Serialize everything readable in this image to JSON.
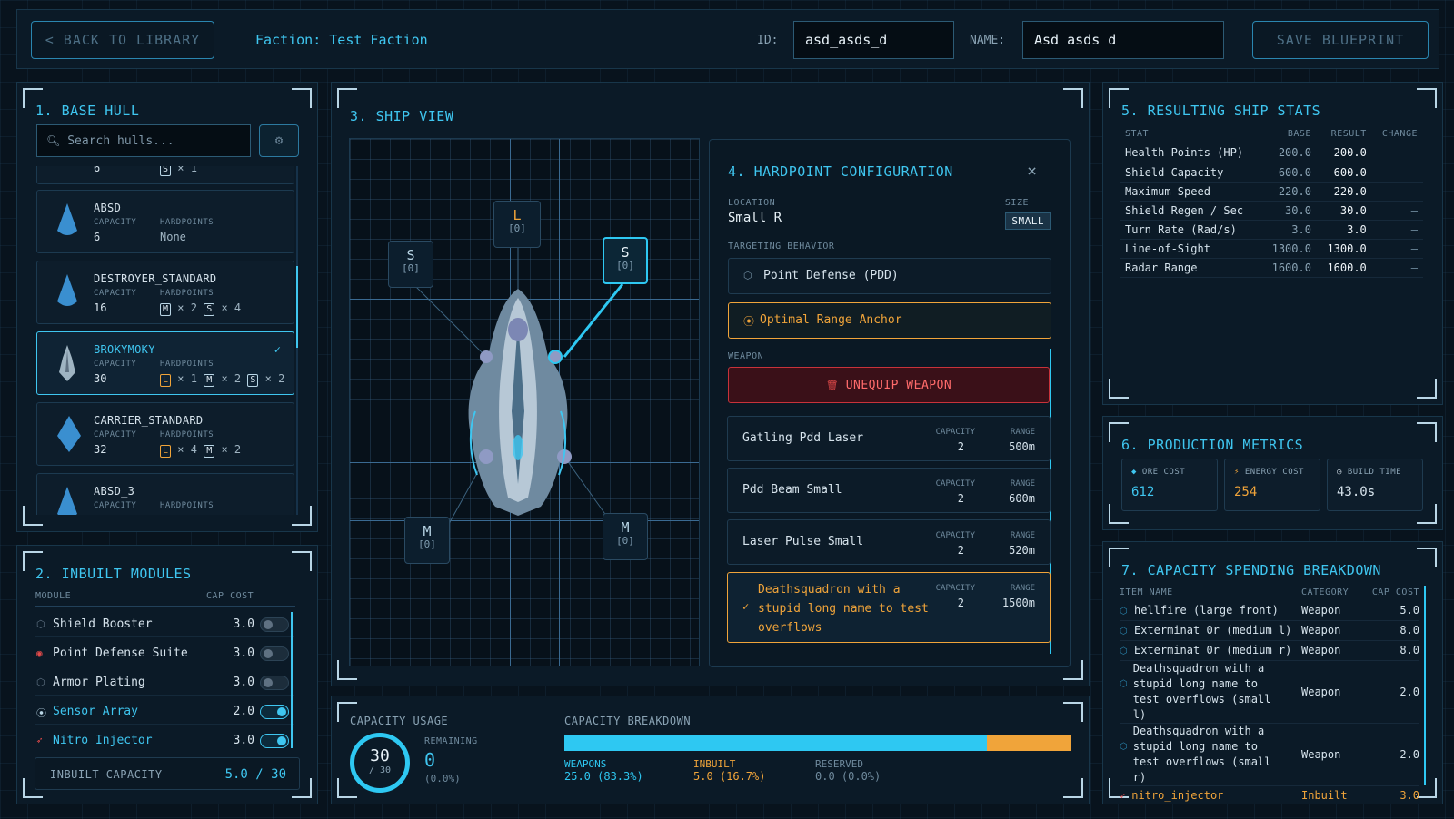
{
  "topbar": {
    "back_label": "< BACK TO LIBRARY",
    "faction": "Faction: Test Faction",
    "id_label": "ID:",
    "id_value": "asd_asds_d",
    "name_label": "NAME:",
    "name_value": "Asd asds d",
    "save_label": "SAVE BLUEPRINT"
  },
  "hulls": {
    "title": "1. BASE HULL",
    "search_placeholder": "Search hulls...",
    "capacity_label": "CAPACITY",
    "hardpoints_label": "HARDPOINTS",
    "partial_top": {
      "capacity": "6",
      "hardpoints": [
        {
          "size": "S",
          "count": "× 1"
        }
      ]
    },
    "items": [
      {
        "name": "ABSD",
        "capacity": "6",
        "hardpoints_text": "None",
        "hardpoints": []
      },
      {
        "name": "DESTROYER_STANDARD",
        "capacity": "16",
        "hardpoints": [
          {
            "size": "M",
            "count": "× 2"
          },
          {
            "size": "S",
            "count": "× 4"
          }
        ]
      },
      {
        "name": "BROKYMOKY",
        "capacity": "30",
        "selected": true,
        "hardpoints": [
          {
            "size": "L",
            "count": "× 1"
          },
          {
            "size": "M",
            "count": "× 2"
          },
          {
            "size": "S",
            "count": "× 2"
          }
        ]
      },
      {
        "name": "CARRIER_STANDARD",
        "capacity": "32",
        "hardpoints": [
          {
            "size": "L",
            "count": "× 4"
          },
          {
            "size": "M",
            "count": "× 2"
          }
        ]
      },
      {
        "name": "ABSD_3",
        "capacity": "",
        "hardpoints": []
      }
    ]
  },
  "modules": {
    "title": "2. INBUILT MODULES",
    "col_module": "MODULE",
    "col_cost": "CAP COST",
    "items": [
      {
        "name": "Shield Booster",
        "cost": "3.0",
        "on": false,
        "icon": "shield-icon"
      },
      {
        "name": "Point Defense Suite",
        "cost": "3.0",
        "on": false,
        "icon": "target-icon"
      },
      {
        "name": "Armor Plating",
        "cost": "3.0",
        "on": false,
        "icon": "shield-icon"
      },
      {
        "name": "Sensor Array",
        "cost": "2.0",
        "on": true,
        "icon": "satellite-icon"
      },
      {
        "name": "Nitro Injector",
        "cost": "3.0",
        "on": true,
        "icon": "rocket-icon"
      }
    ],
    "inbuilt_label": "INBUILT CAPACITY",
    "inbuilt_value": "5.0 / 30"
  },
  "shipview": {
    "title": "3. SHIP VIEW",
    "slots": [
      {
        "size": "L",
        "count": "[0]"
      },
      {
        "size": "S",
        "count": "[0]"
      },
      {
        "size": "S",
        "count": "[0]"
      },
      {
        "size": "M",
        "count": "[0]"
      },
      {
        "size": "M",
        "count": "[0]"
      }
    ]
  },
  "hardpoint": {
    "title": "4. HARDPOINT CONFIGURATION",
    "close": "×",
    "location_label": "LOCATION",
    "location_value": "Small R",
    "size_label": "SIZE",
    "size_value": "SMALL",
    "targeting_label": "TARGETING BEHAVIOR",
    "targeting_options": [
      "Point Defense (PDD)",
      "Optimal Range Anchor"
    ],
    "weapon_label": "WEAPON",
    "unequip_label": "UNEQUIP WEAPON",
    "capacity_label": "CAPACITY",
    "range_label": "RANGE",
    "weapons": [
      {
        "name": "Gatling Pdd Laser",
        "capacity": "2",
        "range": "500m"
      },
      {
        "name": "Pdd Beam Small",
        "capacity": "2",
        "range": "600m"
      },
      {
        "name": "Laser Pulse Small",
        "capacity": "2",
        "range": "520m"
      },
      {
        "name": "Deathsquadron with a stupid long name to test overflows",
        "capacity": "2",
        "range": "1500m",
        "selected": true
      }
    ]
  },
  "capacity": {
    "usage_label": "CAPACITY USAGE",
    "total": "30",
    "total_sub": "/ 30",
    "remaining_label": "REMAINING",
    "remaining_value": "0",
    "remaining_pct": "(0.0%)",
    "breakdown_label": "CAPACITY BREAKDOWN",
    "weapons_fraction": 0.833,
    "inbuilt_fraction": 0.167,
    "legend": [
      {
        "label": "WEAPONS",
        "value": "25.0 (83.3%)",
        "color": "#2ec8f2"
      },
      {
        "label": "INBUILT",
        "value": "5.0 (16.7%)",
        "color": "#f0a43a"
      },
      {
        "label": "RESERVED",
        "value": "0.0 (0.0%)",
        "color": "#6f8a9d"
      }
    ]
  },
  "stats": {
    "title": "5. RESULTING SHIP STATS",
    "headers": [
      "STAT",
      "BASE",
      "RESULT",
      "CHANGE"
    ],
    "rows": [
      [
        "Health Points (HP)",
        "200.0",
        "200.0",
        "—"
      ],
      [
        "Shield Capacity",
        "600.0",
        "600.0",
        "—"
      ],
      [
        "Maximum Speed",
        "220.0",
        "220.0",
        "—"
      ],
      [
        "Shield Regen / Sec",
        "30.0",
        "30.0",
        "—"
      ],
      [
        "Turn Rate (Rad/s)",
        "3.0",
        "3.0",
        "—"
      ],
      [
        "Line-of-Sight",
        "1300.0",
        "1300.0",
        "—"
      ],
      [
        "Radar Range",
        "1600.0",
        "1600.0",
        "—"
      ]
    ]
  },
  "production": {
    "title": "6. PRODUCTION METRICS",
    "metrics": [
      {
        "label": "ORE COST",
        "value": "612",
        "color": "#3fc6f0",
        "icon": "gem-icon"
      },
      {
        "label": "ENERGY COST",
        "value": "254",
        "color": "#f0a43a",
        "icon": "bolt-icon"
      },
      {
        "label": "BUILD TIME",
        "value": "43.0s",
        "color": "#d6e3ec",
        "icon": "clock-icon"
      }
    ]
  },
  "spending": {
    "title": "7. CAPACITY SPENDING BREAKDOWN",
    "headers": [
      "ITEM NAME",
      "CATEGORY",
      "CAP COST"
    ],
    "rows": [
      {
        "name": "hellfire (large front)",
        "category": "Weapon",
        "cost": "5.0"
      },
      {
        "name": "Exterminat 0r (medium l)",
        "category": "Weapon",
        "cost": "8.0"
      },
      {
        "name": "Exterminat 0r (medium r)",
        "category": "Weapon",
        "cost": "8.0"
      },
      {
        "name": "Deathsquadron with a stupid long name to test overflows (small l)",
        "category": "Weapon",
        "cost": "2.0"
      },
      {
        "name": "Deathsquadron with a stupid long name to test overflows (small r)",
        "category": "Weapon",
        "cost": "2.0"
      },
      {
        "name": "nitro_injector",
        "category": "Inbuilt",
        "cost": "3.0",
        "inbuilt": true
      }
    ]
  }
}
